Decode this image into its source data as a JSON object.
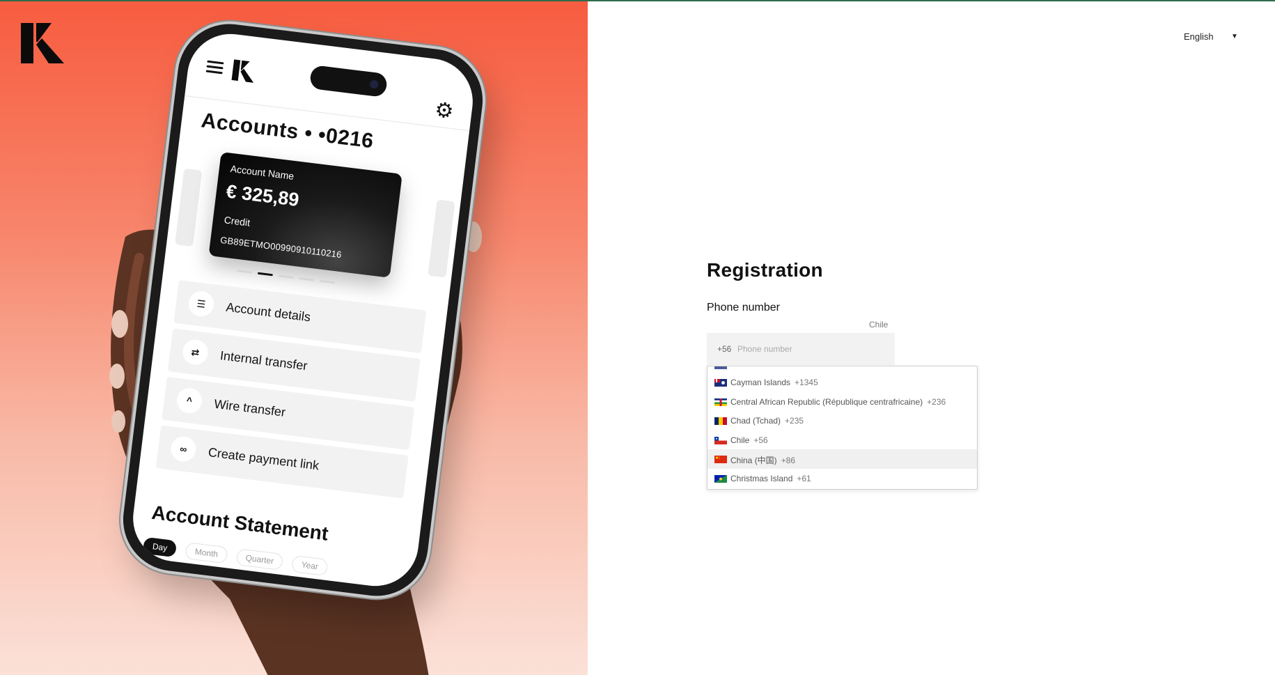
{
  "brand": {
    "logo_icon": "k-logo-icon"
  },
  "hero": {
    "phone_app": {
      "accounts_title": "Accounts • •0216",
      "card": {
        "name": "Account Name",
        "amount": "€ 325,89",
        "type": "Credit",
        "iban": "GB89ETMO00990910110216"
      },
      "menu": [
        {
          "label": "Account details",
          "icon": "list-icon"
        },
        {
          "label": "Internal transfer",
          "icon": "transfer-icon"
        },
        {
          "label": "Wire transfer",
          "icon": "arrow-up-icon"
        },
        {
          "label": "Create payment link",
          "icon": "link-icon"
        }
      ],
      "statement_title": "Account Statement",
      "periods": [
        "Day",
        "Month",
        "Quarter",
        "Year"
      ],
      "selected_period": "Day"
    }
  },
  "language": {
    "label": "English",
    "icon": "caret-down-icon"
  },
  "form": {
    "title": "Registration",
    "phone_label": "Phone number",
    "selected_country": "Chile",
    "dial_code": "+56",
    "phone_placeholder": "Phone number",
    "phone_value": ""
  },
  "country_dropdown": {
    "highlighted": "China (中国)",
    "items": [
      {
        "name": "Cayman Islands",
        "code": "+1345",
        "flag": "cayman-flag-icon"
      },
      {
        "name": "Central African Republic (République centrafricaine)",
        "code": "+236",
        "flag": "car-flag-icon"
      },
      {
        "name": "Chad (Tchad)",
        "code": "+235",
        "flag": "chad-flag-icon"
      },
      {
        "name": "Chile",
        "code": "+56",
        "flag": "chile-flag-icon"
      },
      {
        "name": "China (中国)",
        "code": "+86",
        "flag": "china-flag-icon"
      },
      {
        "name": "Christmas Island",
        "code": "+61",
        "flag": "christmas-island-flag-icon"
      }
    ]
  },
  "colors": {
    "hero_top": "#f75c3f",
    "hero_bottom": "#fbe1d8",
    "field_bg": "#f2f2f2",
    "highlight_bg": "#f0f0f0",
    "top_border": "#2f6b4a"
  }
}
